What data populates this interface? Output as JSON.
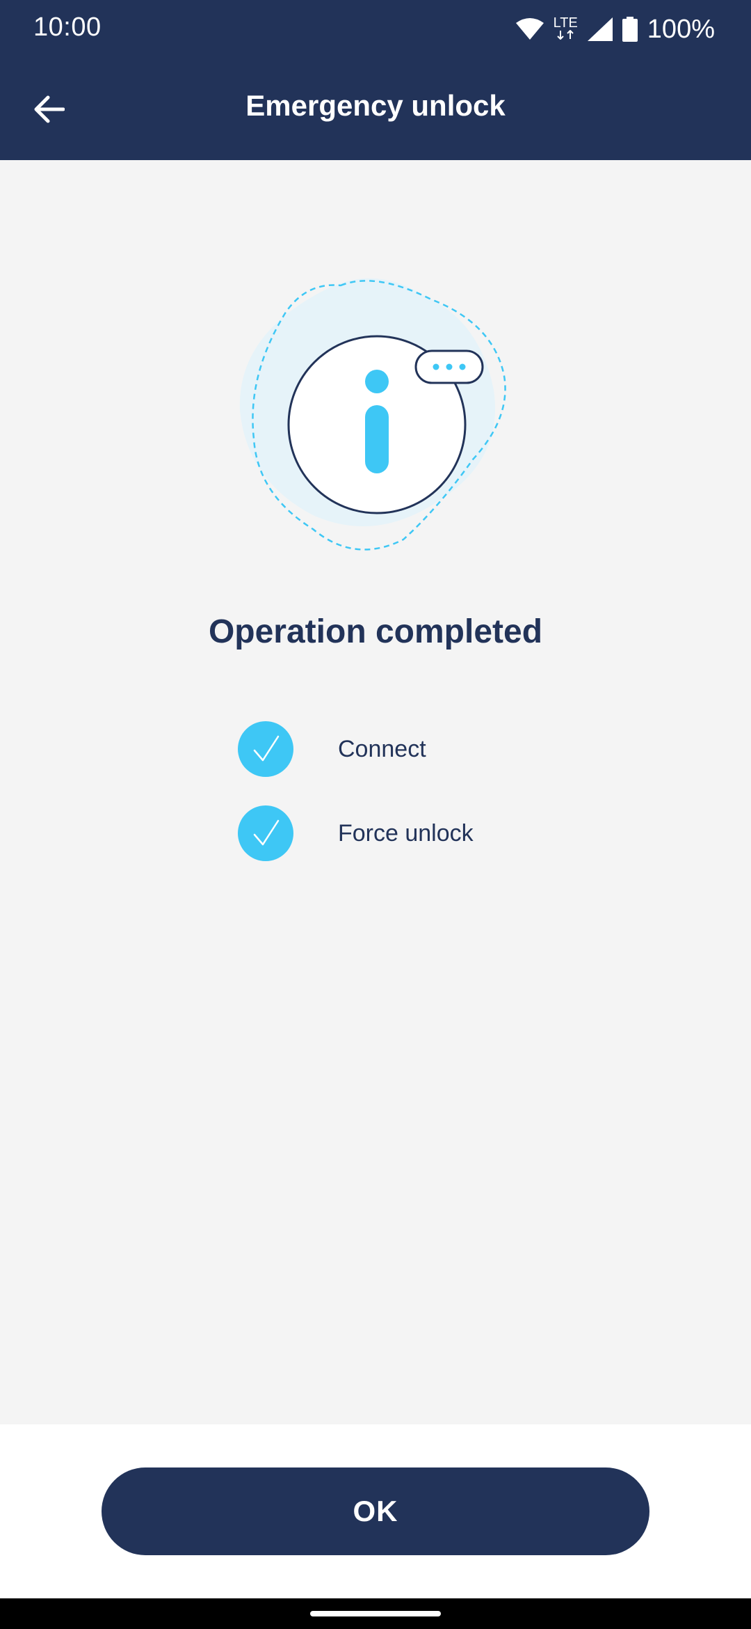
{
  "status_bar": {
    "time": "10:00",
    "network_label": "LTE",
    "battery": "100%",
    "icons": [
      "wifi-icon",
      "lte-icon",
      "signal-icon",
      "battery-icon"
    ]
  },
  "app_bar": {
    "title": "Emergency unlock",
    "back_icon": "arrow-left-icon"
  },
  "main": {
    "illustration_icon": "info-icon",
    "heading": "Operation completed",
    "steps": [
      {
        "label": "Connect",
        "status": "done"
      },
      {
        "label": "Force unlock",
        "status": "done"
      }
    ]
  },
  "footer": {
    "ok_label": "OK"
  },
  "colors": {
    "primary": "#223359",
    "accent": "#3ec7f5",
    "background": "#f4f4f4",
    "blob": "#e6f3f9"
  }
}
